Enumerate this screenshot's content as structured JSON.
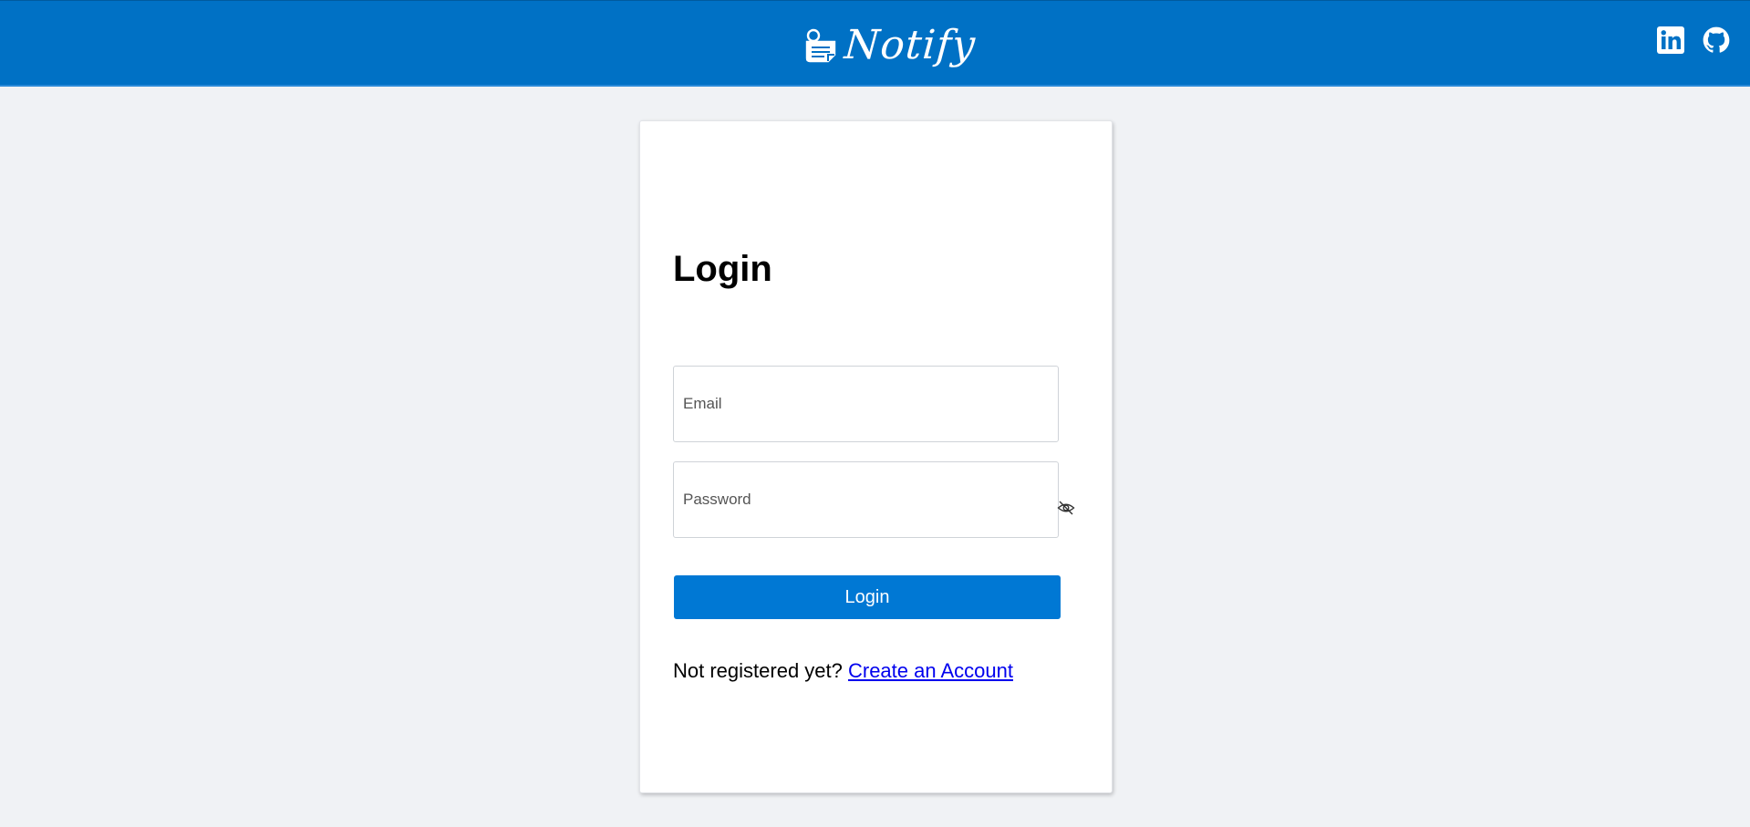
{
  "header": {
    "brand_name": "Notify",
    "background_color": "#0071c5",
    "logo_icon": "notepad-icon",
    "social": [
      {
        "name": "LinkedIn",
        "icon": "linkedin-icon"
      },
      {
        "name": "GitHub",
        "icon": "github-icon"
      }
    ]
  },
  "login_form": {
    "title": "Login",
    "email_placeholder": "Email",
    "password_placeholder": "Password",
    "password_toggle_icon": "eye-slash-icon",
    "submit_label": "Login",
    "submit_color": "#0078d4",
    "register_prompt": "Not registered yet? ",
    "register_link_label": "Create an Account"
  }
}
